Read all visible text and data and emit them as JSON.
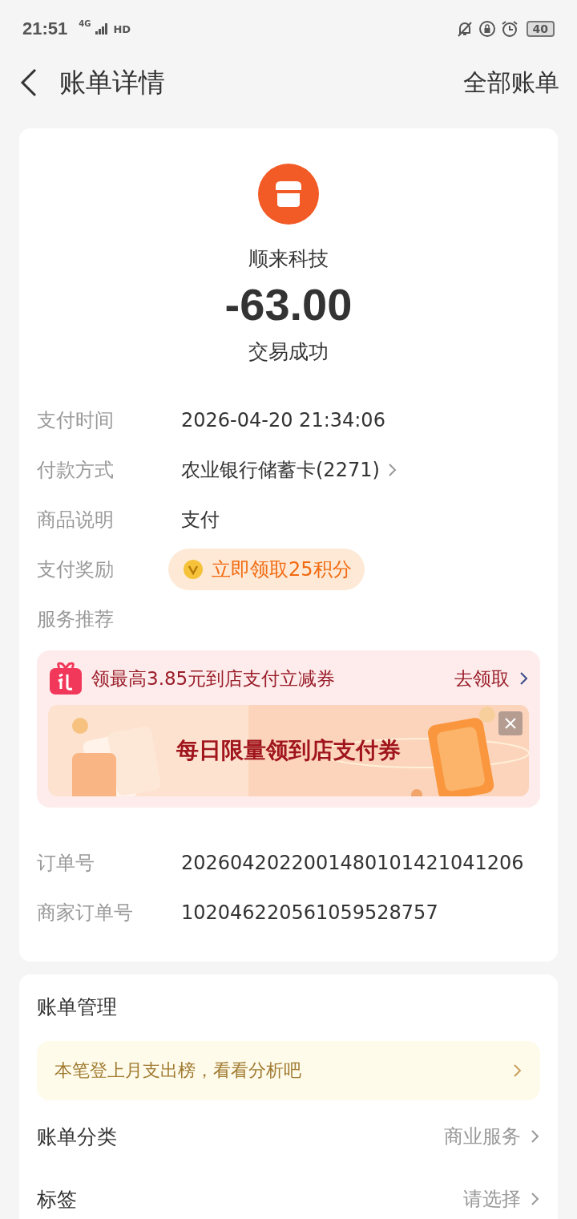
{
  "status_bar": {
    "time": "21:51",
    "network": "4G",
    "hd": "HD",
    "battery": "40"
  },
  "header": {
    "title": "账单详情",
    "action": "全部账单"
  },
  "merchant": {
    "name": "顺来科技",
    "amount": "-63.00",
    "status": "交易成功"
  },
  "details": [
    {
      "label": "支付时间",
      "value": "2026-04-20 21:34:06",
      "kind": "text"
    },
    {
      "label": "付款方式",
      "value": "农业银行储蓄卡(2271)",
      "kind": "link"
    },
    {
      "label": "商品说明",
      "value": "支付",
      "kind": "text"
    },
    {
      "label": "支付奖励",
      "value": "立即领取25积分",
      "kind": "reward"
    }
  ],
  "service": {
    "title": "服务推荐",
    "promo": "领最高3.85元到店支付立减券",
    "action": "去领取",
    "banner": "每日限量领到店支付券"
  },
  "orders": [
    {
      "label": "订单号",
      "value": "2026042022001480101421041206"
    },
    {
      "label": "商家订单号",
      "value": "102046220561059528757"
    }
  ],
  "management": {
    "title": "账单管理",
    "tip": "本笔登上月支出榜，看看分析吧",
    "rows": [
      {
        "label": "账单分类",
        "value": "商业服务"
      },
      {
        "label": "标签",
        "value": "请选择"
      }
    ]
  }
}
